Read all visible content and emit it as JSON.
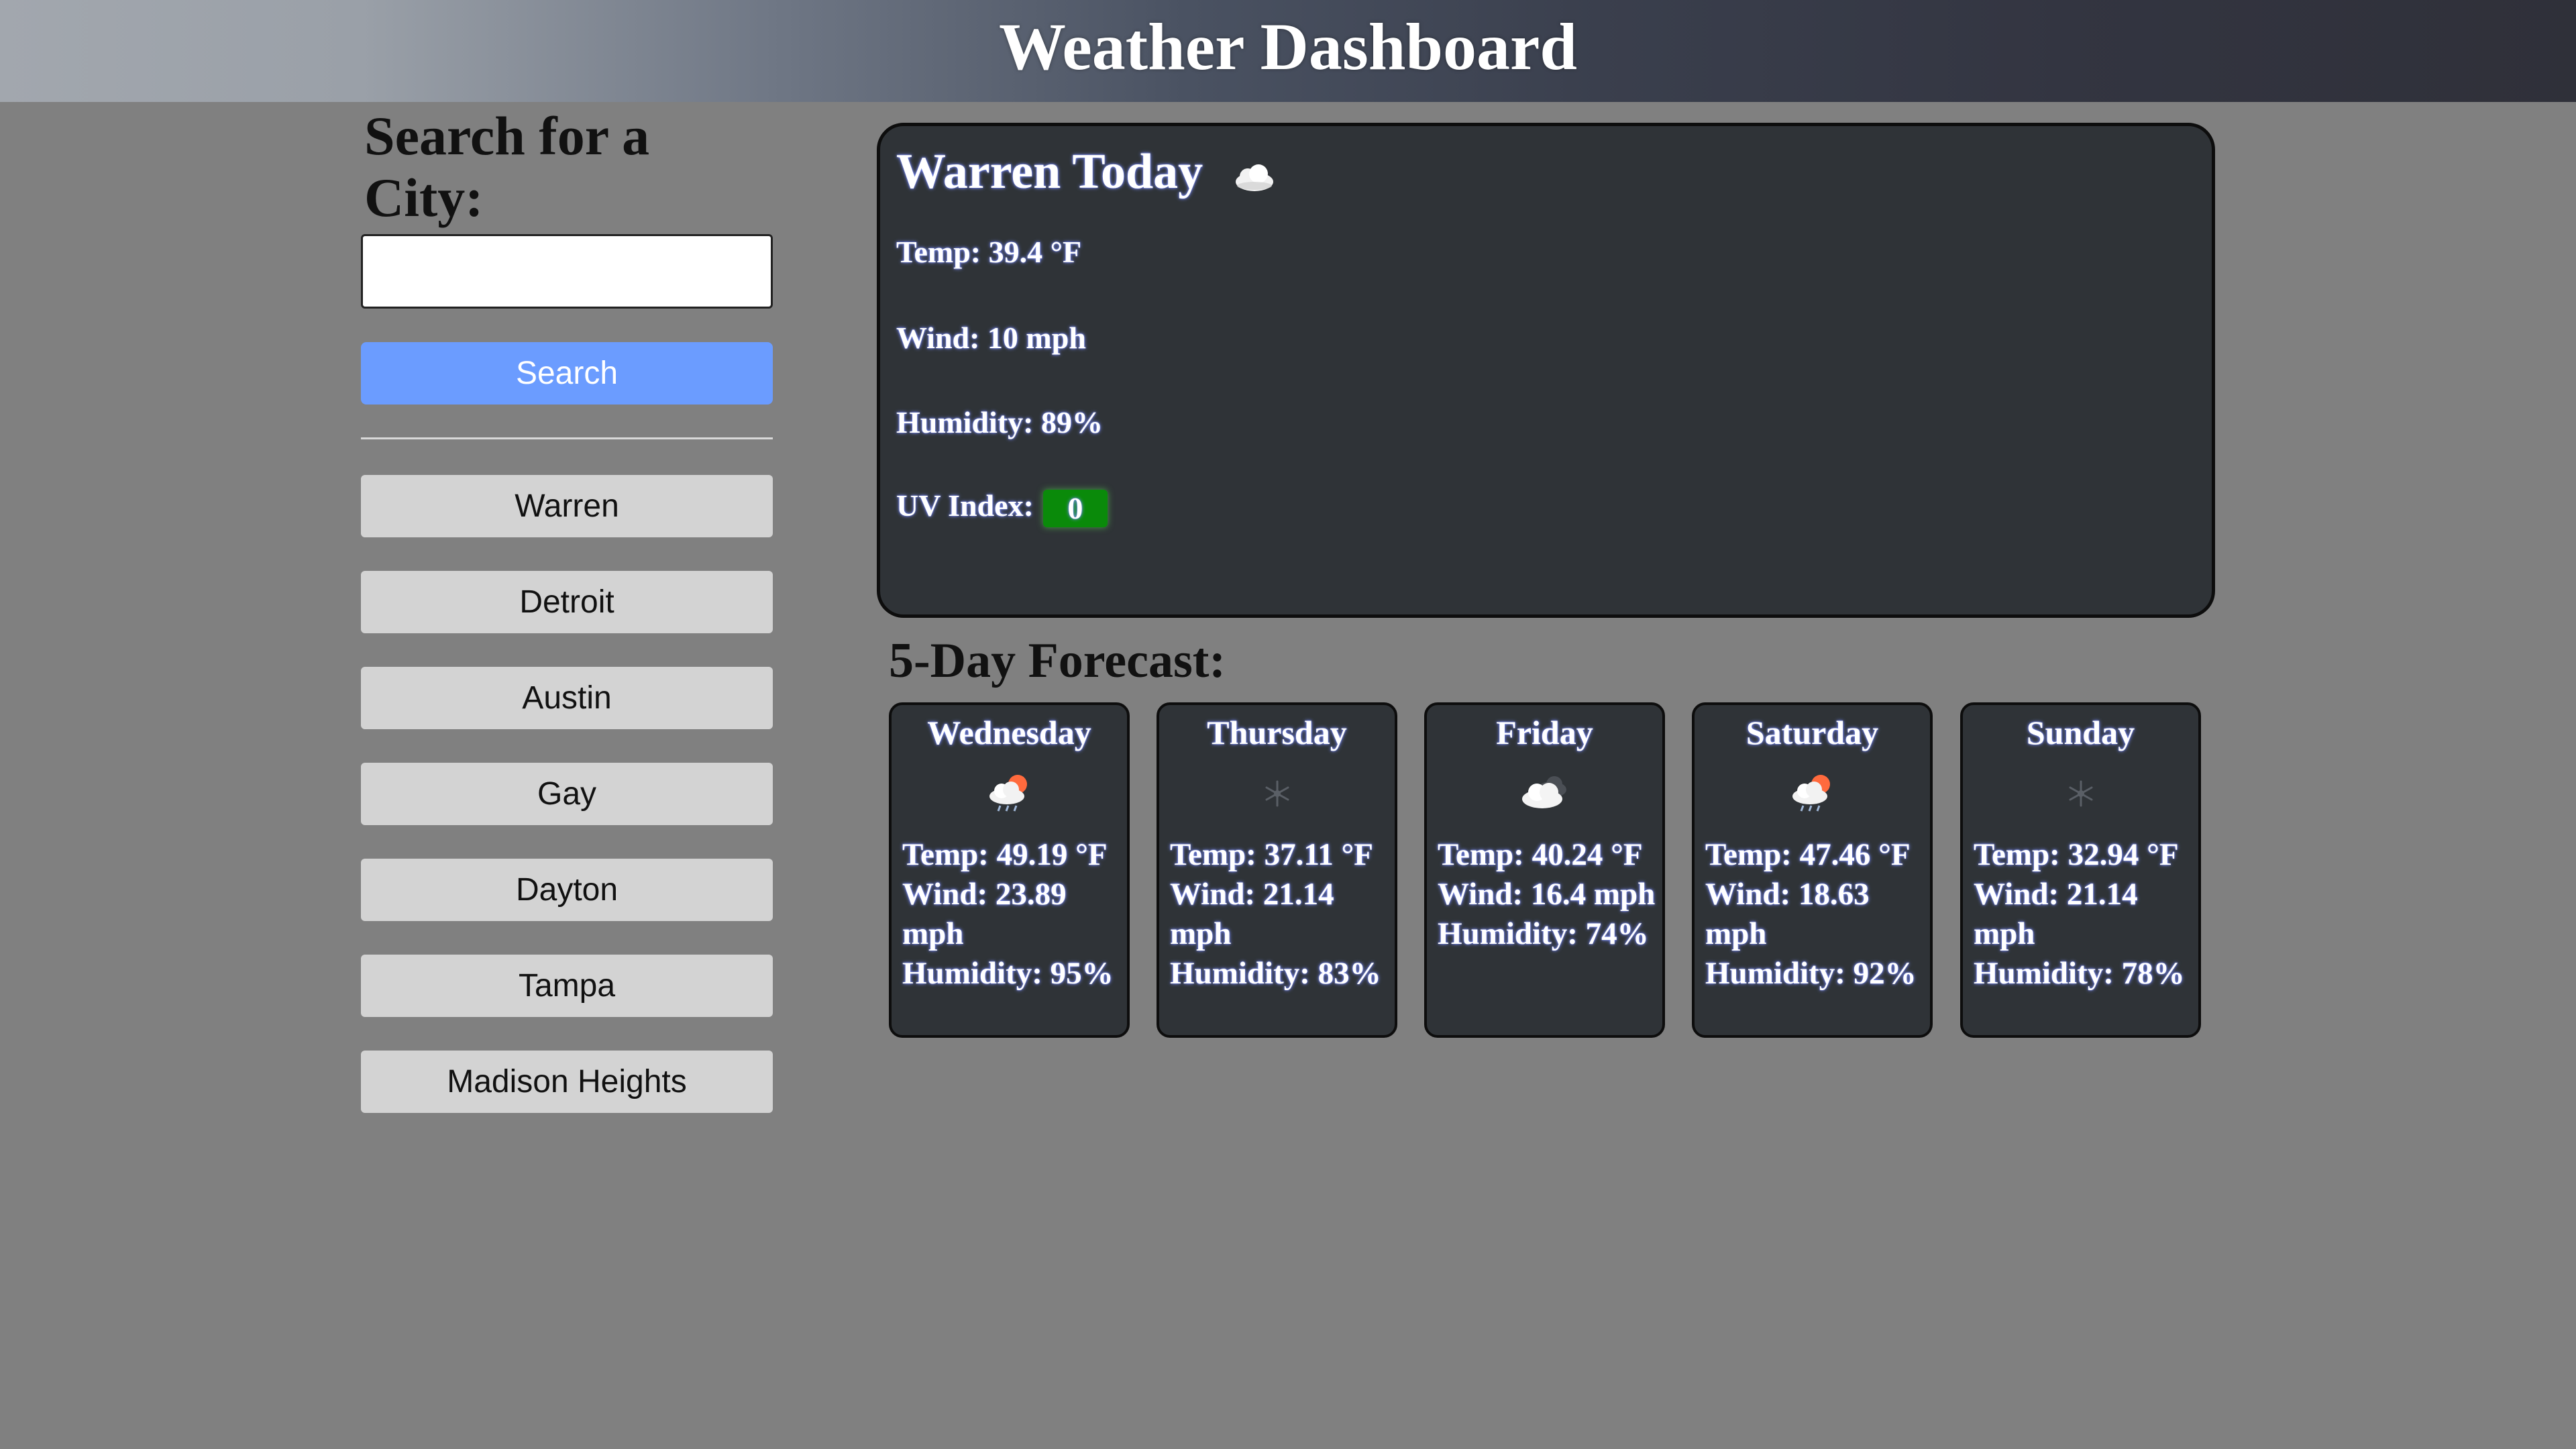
{
  "header": {
    "title": "Weather Dashboard"
  },
  "sidebar": {
    "heading": "Search for a City:",
    "input_value": "",
    "search_label": "Search",
    "history": [
      {
        "label": "Warren"
      },
      {
        "label": "Detroit"
      },
      {
        "label": "Austin"
      },
      {
        "label": "Gay"
      },
      {
        "label": "Dayton"
      },
      {
        "label": "Tampa"
      },
      {
        "label": "Madison Heights"
      }
    ]
  },
  "current": {
    "title": "Warren Today",
    "icon": "cloud-icon",
    "temp": "Temp: 39.4 °F",
    "wind": "Wind: 10 mph",
    "humidity": "Humidity: 89%",
    "uv_label": "UV Index:",
    "uv_value": "0",
    "uv_color": "#0a8a0a"
  },
  "forecast": {
    "heading": "5-Day Forecast:",
    "days": [
      {
        "day": "Wednesday",
        "icon": "rain-cloud-sun-icon",
        "temp": "Temp: 49.19 °F",
        "wind": "Wind: 23.89 mph",
        "humidity": "Humidity: 95%"
      },
      {
        "day": "Thursday",
        "icon": "snow-icon",
        "temp": "Temp: 37.11 °F",
        "wind": "Wind: 21.14 mph",
        "humidity": "Humidity: 83%"
      },
      {
        "day": "Friday",
        "icon": "broken-clouds-icon",
        "temp": "Temp: 40.24 °F",
        "wind": "Wind: 16.4 mph",
        "humidity": "Humidity: 74%"
      },
      {
        "day": "Saturday",
        "icon": "rain-cloud-sun-icon",
        "temp": "Temp: 47.46 °F",
        "wind": "Wind: 18.63 mph",
        "humidity": "Humidity: 92%"
      },
      {
        "day": "Sunday",
        "icon": "snow-icon",
        "temp": "Temp: 32.94 °F",
        "wind": "Wind: 21.14 mph",
        "humidity": "Humidity: 78%"
      }
    ]
  },
  "colors": {
    "background": "#808080",
    "search_button": "#6b9cff",
    "history_button": "#d3d3d3",
    "card": "#2f3337",
    "text_glow": "#7a8cff"
  }
}
